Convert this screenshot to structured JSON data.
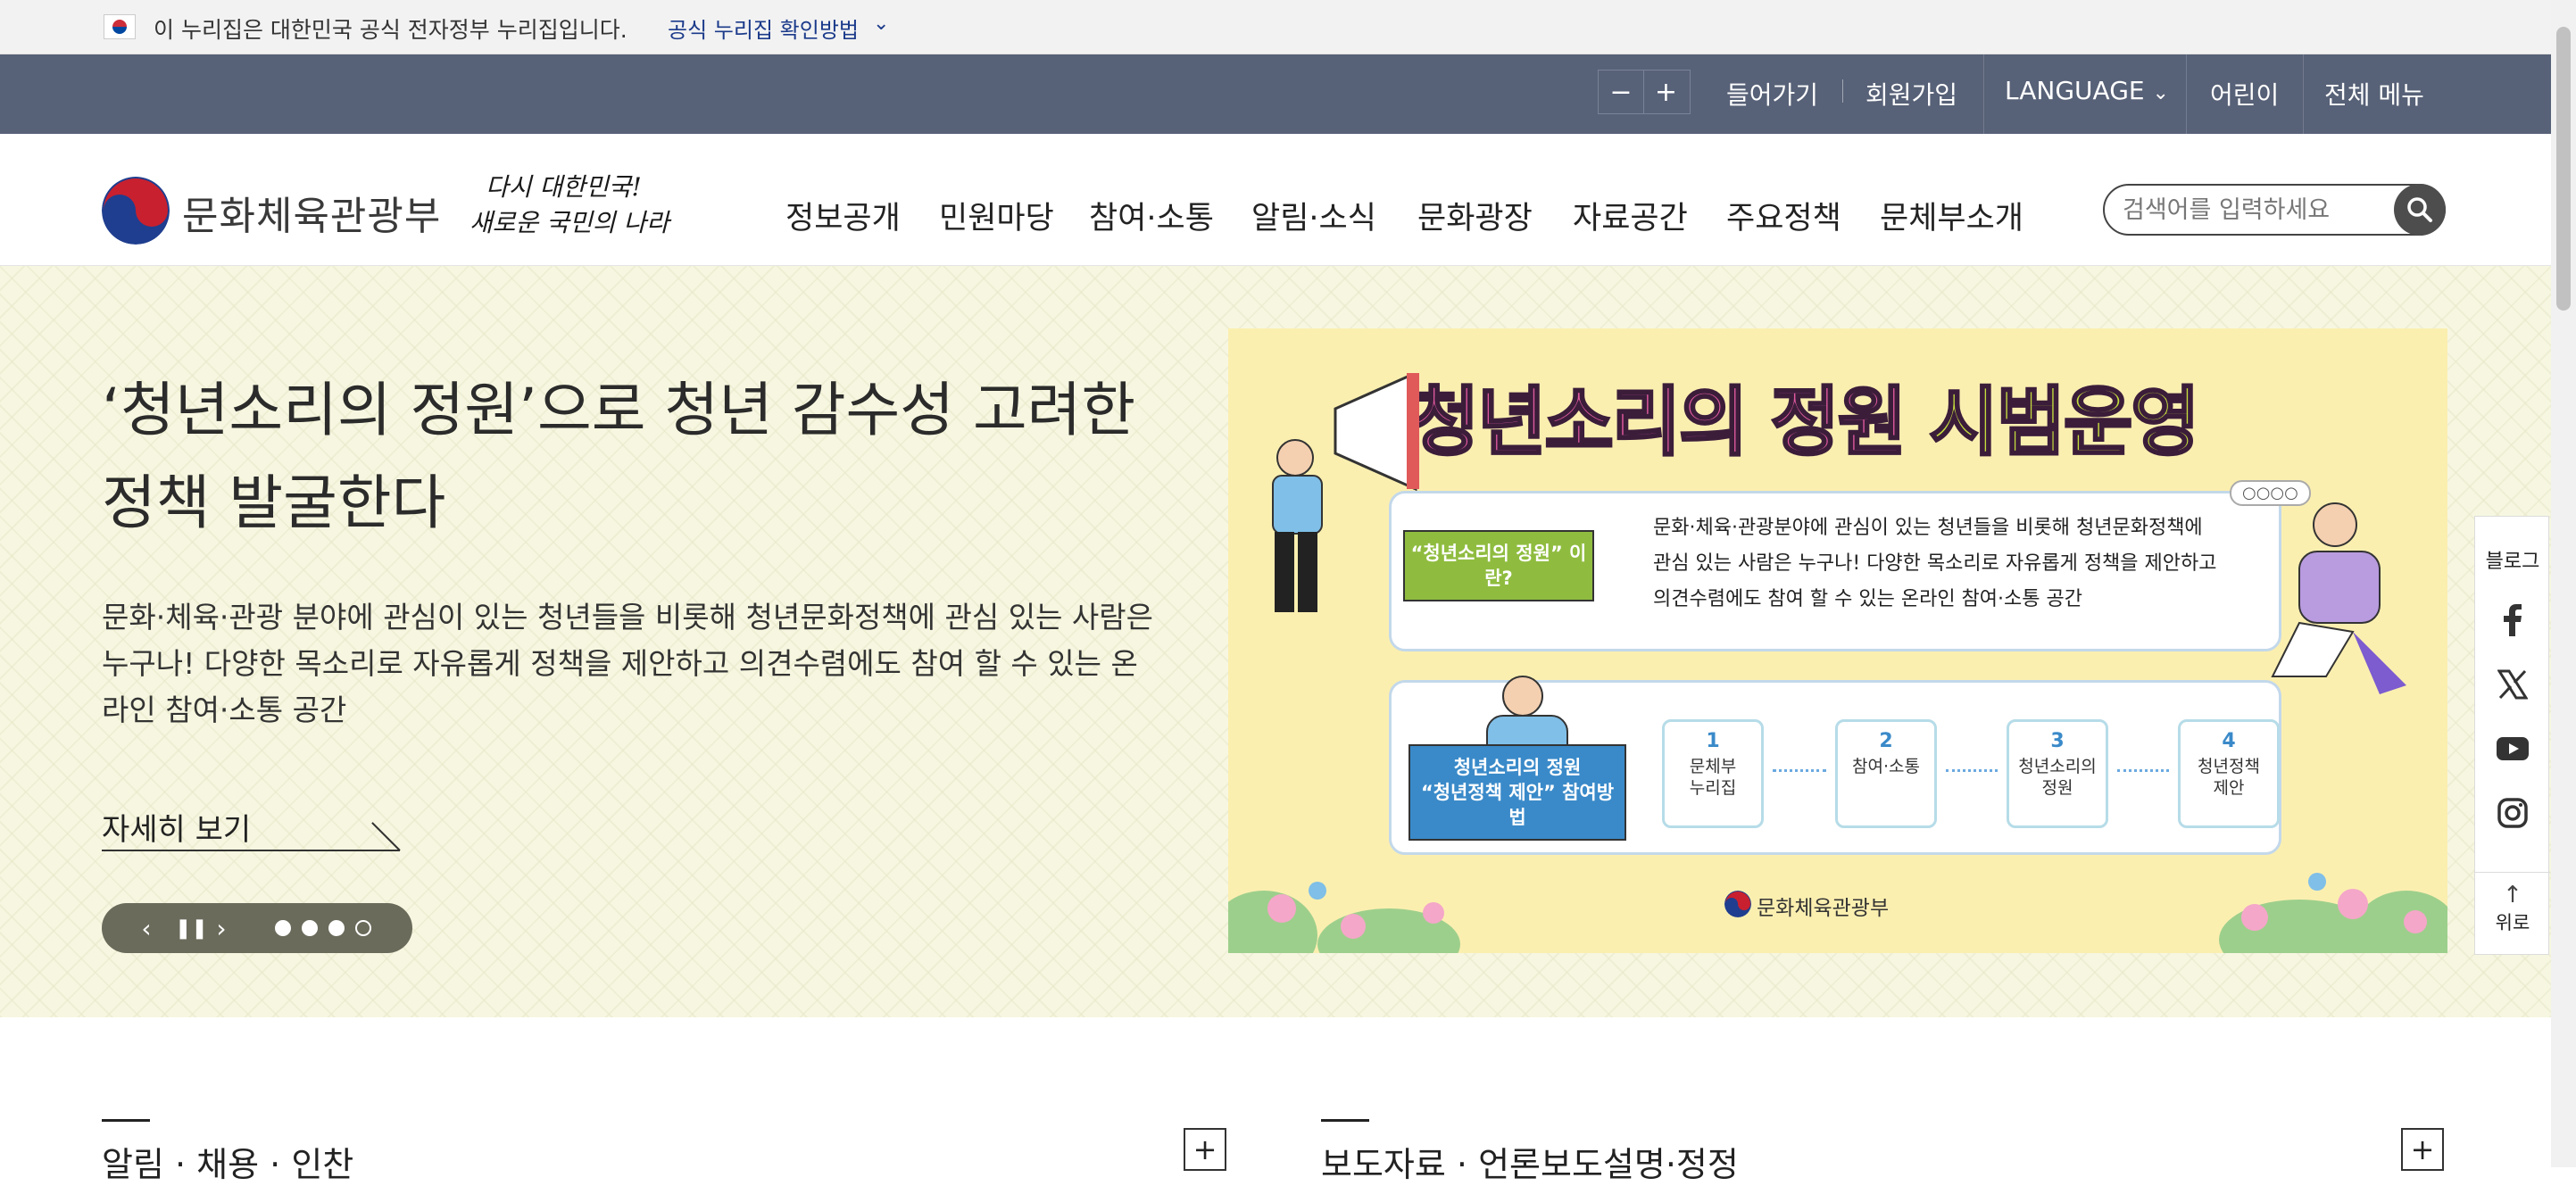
{
  "gov_banner": {
    "text": "이 누리집은 대한민국 공식 전자정부 누리집입니다.",
    "link": "공식 누리집 확인방법",
    "chevron_icon": "chevron-down-icon"
  },
  "utility": {
    "zoom_out": "−",
    "zoom_in": "+",
    "login": "들어가기",
    "signup": "회원가입",
    "language": "LANGUAGE",
    "kids": "어린이",
    "all_menu": "전체 메뉴"
  },
  "header": {
    "logo_text": "문화체육관광부",
    "slogan_line1": "다시 대한민국!",
    "slogan_line2": "새로운 국민의 나라",
    "nav": [
      "정보공개",
      "민원마당",
      "참여·소통",
      "알림·소식",
      "문화광장",
      "자료공간",
      "주요정책",
      "문체부소개"
    ],
    "search_placeholder": "검색어를 입력하세요"
  },
  "hero": {
    "title": "‘청년소리의 정원’으로 청년 감수성 고려한 정책 발굴한다",
    "description": "문화·체육·관광 분야에 관심이 있는 청년들을 비롯해 청년문화정책에 관심 있는 사람은 누구나! 다양한 목소리로 자유롭게 정책을 제안하고 의견수렴에도 참여 할 수 있는 온라인 참여·소통 공간",
    "more": "자세히 보기",
    "slide_count": 4,
    "active_slide": 4
  },
  "banner": {
    "title_a": "청년소리의 정원",
    "title_b": "시범운영",
    "tag1": "“청년소리의 정원” 이란?",
    "card1_text_1": "문화·체육·관광분야에 관심이 있는 청년들을 비롯해 청년문화정책에",
    "card1_text_2": "관심 있는 사람은 누구나! 다양한 목소리로 자유롭게 정책을 제안하고",
    "card1_text_3": "의견수렴에도 참여 할 수 있는 온라인 참여·소통 공간",
    "tag2_line1": "청년소리의 정원",
    "tag2_line2": "“청년정책 제안” 참여방법",
    "steps": [
      {
        "num": "1",
        "label1": "문체부",
        "label2": "누리집"
      },
      {
        "num": "2",
        "label1": "참여·소통",
        "label2": ""
      },
      {
        "num": "3",
        "label1": "청년소리의",
        "label2": "정원"
      },
      {
        "num": "4",
        "label1": "청년정책",
        "label2": "제안"
      }
    ],
    "logo": "문화체육관광부",
    "bubble": "○○○○"
  },
  "share": {
    "label": "블로그",
    "top": "위로",
    "icons": [
      "facebook-icon",
      "x-icon",
      "youtube-icon",
      "instagram-icon"
    ]
  },
  "sections": {
    "left_title": "알림 · 채용 · 인찬",
    "right_title": "보도자료 · 언론보도설명·정정",
    "plus": "+"
  },
  "colors": {
    "util_bar": "#576177",
    "hero_bg": "#f7f7e1",
    "banner_bg": "#fbefb0",
    "title_pink": "#e25aa0",
    "title_green": "#c5dd3e"
  }
}
